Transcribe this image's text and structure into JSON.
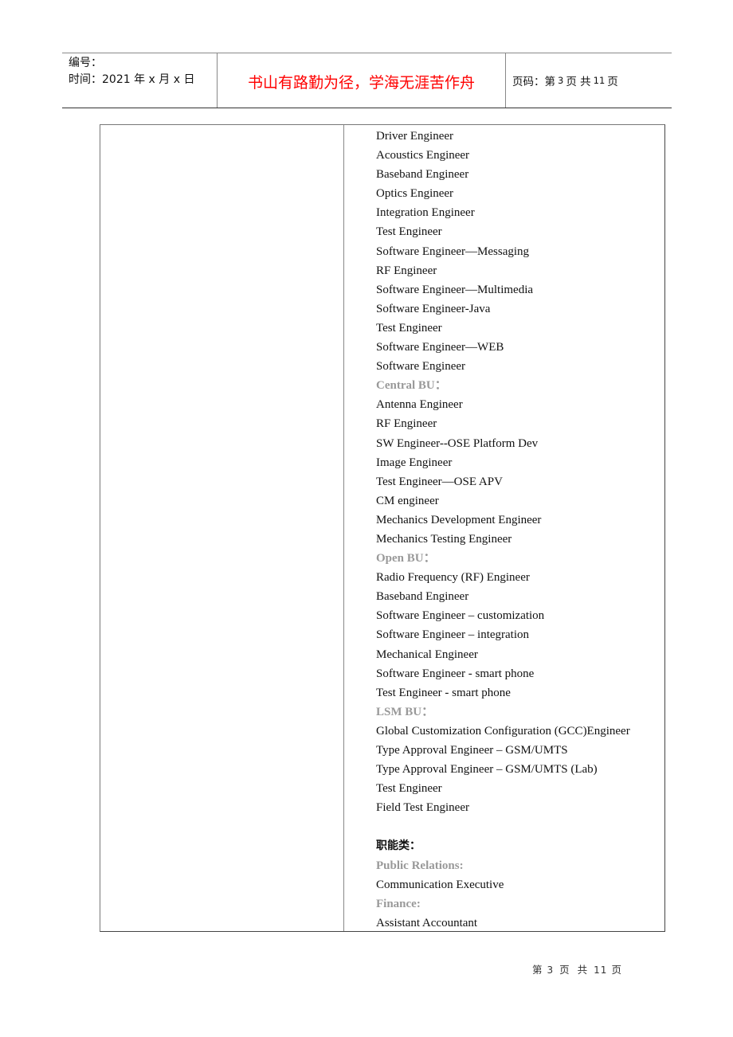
{
  "header": {
    "number_label": "编号：",
    "date_label": "时间：2021 年 x 月 x 日",
    "motto": "书山有路勤为径，学海无涯苦作舟",
    "page_prefix": "页码：第",
    "page_current": "3",
    "page_mid": "页 共",
    "page_total": "11",
    "page_suffix": "页"
  },
  "content": {
    "lines": [
      {
        "type": "item",
        "text": "Driver Engineer"
      },
      {
        "type": "item",
        "text": "Acoustics Engineer"
      },
      {
        "type": "item",
        "text": "Baseband Engineer"
      },
      {
        "type": "item",
        "text": "Optics Engineer"
      },
      {
        "type": "item",
        "text": "Integration Engineer"
      },
      {
        "type": "item",
        "text": "Test Engineer"
      },
      {
        "type": "item",
        "text": "Software Engineer—Messaging"
      },
      {
        "type": "item",
        "text": "RF Engineer"
      },
      {
        "type": "item",
        "text": "Software Engineer—Multimedia"
      },
      {
        "type": "item",
        "text": "Software Engineer-Java"
      },
      {
        "type": "item",
        "text": "Test Engineer"
      },
      {
        "type": "item",
        "text": "Software Engineer—WEB"
      },
      {
        "type": "item",
        "text": "Software Engineer"
      },
      {
        "type": "section",
        "text": "Central BU："
      },
      {
        "type": "item",
        "text": "Antenna Engineer"
      },
      {
        "type": "item",
        "text": "RF Engineer"
      },
      {
        "type": "item",
        "text": "SW Engineer--OSE Platform Dev"
      },
      {
        "type": "item",
        "text": "Image Engineer"
      },
      {
        "type": "item",
        "text": "Test Engineer—OSE APV"
      },
      {
        "type": "item",
        "text": "CM engineer"
      },
      {
        "type": "item",
        "text": "Mechanics Development Engineer"
      },
      {
        "type": "item",
        "text": "Mechanics Testing Engineer"
      },
      {
        "type": "section",
        "text": "Open BU："
      },
      {
        "type": "item",
        "text": "Radio Frequency (RF) Engineer"
      },
      {
        "type": "item",
        "text": "Baseband Engineer"
      },
      {
        "type": "item",
        "text": "Software Engineer – customization"
      },
      {
        "type": "item",
        "text": "Software Engineer – integration"
      },
      {
        "type": "item",
        "text": "Mechanical Engineer"
      },
      {
        "type": "item",
        "text": "Software Engineer - smart phone"
      },
      {
        "type": "item",
        "text": "Test Engineer - smart phone"
      },
      {
        "type": "section",
        "text": "LSM BU："
      },
      {
        "type": "item",
        "text": "Global Customization Configuration (GCC)Engineer"
      },
      {
        "type": "item",
        "text": "Type Approval Engineer – GSM/UMTS"
      },
      {
        "type": "item",
        "text": "Type Approval Engineer – GSM/UMTS (Lab)"
      },
      {
        "type": "item",
        "text": "Test Engineer"
      },
      {
        "type": "item",
        "text": "Field Test Engineer"
      },
      {
        "type": "blank",
        "text": ""
      },
      {
        "type": "heading",
        "text": "职能类："
      },
      {
        "type": "section",
        "text": "Public Relations:"
      },
      {
        "type": "item",
        "text": "Communication Executive"
      },
      {
        "type": "section",
        "text": "Finance:"
      },
      {
        "type": "item",
        "text": "Assistant Accountant"
      }
    ]
  },
  "footer": {
    "prefix": "第",
    "current": "3",
    "mid1": "页",
    "mid2": "共",
    "total": "11",
    "suffix": "页"
  },
  "colors": {
    "motto": "#ff0000",
    "section_label": "#999999",
    "text": "#111111"
  }
}
